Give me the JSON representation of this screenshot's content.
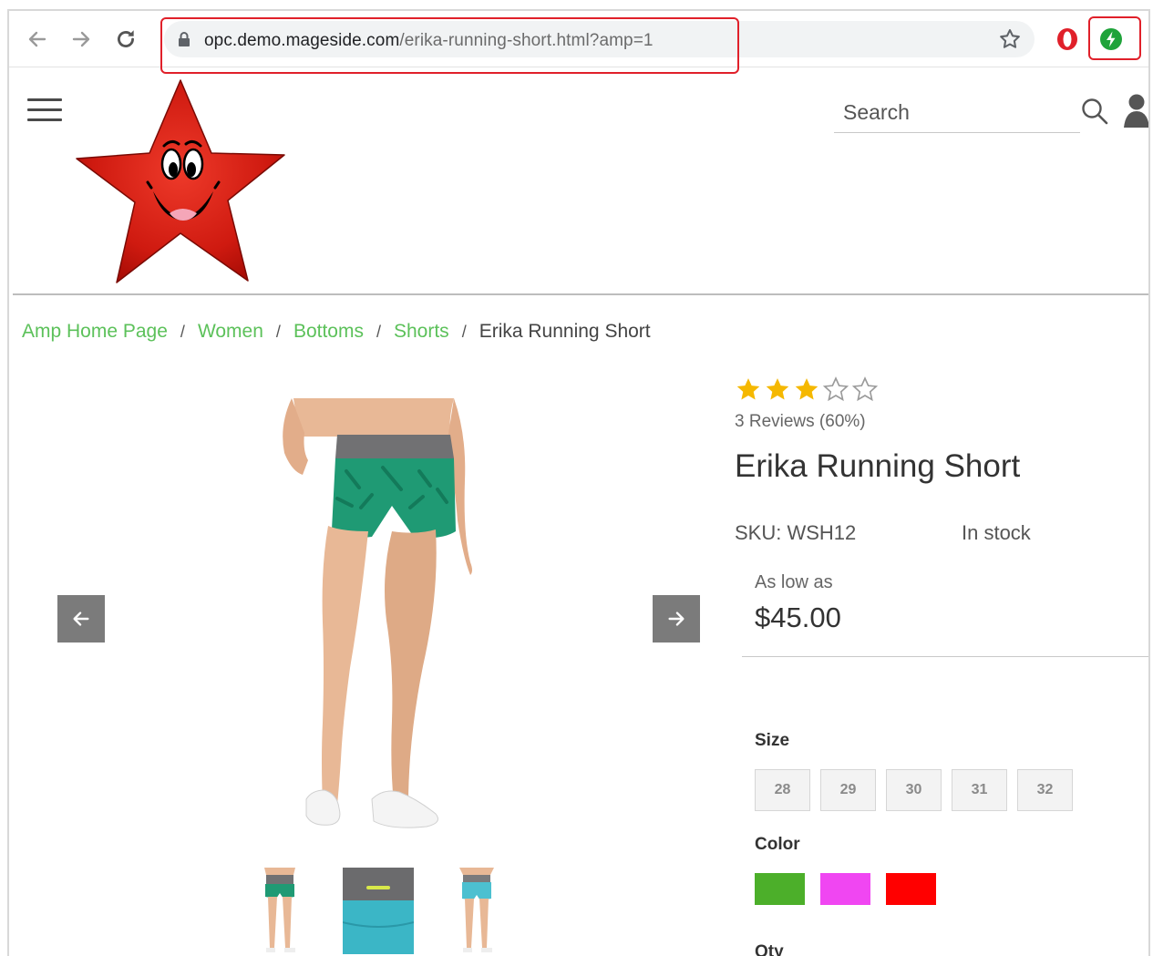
{
  "browser": {
    "url_domain": "opc.demo.mageside.com",
    "url_path": "/erika-running-short.html?amp=1"
  },
  "header": {
    "search_placeholder": "Search"
  },
  "breadcrumb": {
    "items": [
      "Amp Home Page",
      "Women",
      "Bottoms",
      "Shorts"
    ],
    "separator": "/",
    "current": "Erika Running Short"
  },
  "product": {
    "rating": 3,
    "rating_max": 5,
    "reviews_text": "3 Reviews (60%)",
    "name": "Erika Running Short",
    "sku_text": "SKU: WSH12",
    "stock_text": "In stock",
    "price_label": "As low as",
    "price": "$45.00",
    "size_label": "Size",
    "sizes": [
      "28",
      "29",
      "30",
      "31",
      "32"
    ],
    "color_label": "Color",
    "colors": [
      "#4caf2a",
      "#f046f2",
      "#ff0000"
    ],
    "qty_label": "Qty"
  },
  "icons": {
    "back": "arrow-left-icon",
    "forward": "arrow-right-icon",
    "reload": "reload-icon",
    "lock": "lock-icon",
    "bookmark": "star-outline-icon",
    "opera": "opera-icon",
    "amp": "amp-bolt-icon",
    "menu": "hamburger-icon",
    "search": "magnifier-icon",
    "account": "user-icon"
  },
  "theme": {
    "link_green": "#5cc15a",
    "star_gold": "#f5b800",
    "highlight_red": "#e0202a"
  }
}
